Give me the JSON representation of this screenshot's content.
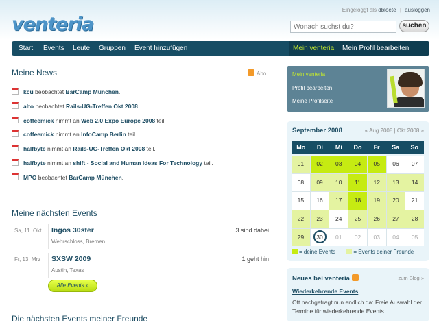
{
  "header": {
    "logo": "venteria",
    "logged_in_label": "Eingeloggt als",
    "username": "dbloete",
    "logout": "ausloggen",
    "search_placeholder": "Wonach suchst du?",
    "search_button": "suchen"
  },
  "nav": {
    "items": [
      "Start",
      "Events",
      "Leute",
      "Gruppen",
      "Event hinzufügen"
    ],
    "right_items": [
      "Mein venteria",
      "Mein Profil bearbeiten"
    ]
  },
  "news": {
    "title": "Meine News",
    "abo": "Abo",
    "items": [
      {
        "user": "kcu",
        "action": "beobachtet",
        "target": "BarCamp München",
        "end": "."
      },
      {
        "user": "alto",
        "action": "beobachtet",
        "target": "Rails-UG-Treffen Okt 2008",
        "end": "."
      },
      {
        "user": "coffeemick",
        "action": "nimmt an",
        "target": "Web 2.0 Expo Europe 2008",
        "end": " teil."
      },
      {
        "user": "coffeemick",
        "action": "nimmt an",
        "target": "InfoCamp Berlin",
        "end": " teil."
      },
      {
        "user": "halfbyte",
        "action": "nimmt an",
        "target": "Rails-UG-Treffen Okt 2008",
        "end": " teil."
      },
      {
        "user": "halfbyte",
        "action": "nimmt an",
        "target": "shift - Social and Human Ideas For Technology",
        "end": " teil."
      },
      {
        "user": "MPO",
        "action": "beobachtet",
        "target": "BarCamp München",
        "end": "."
      }
    ]
  },
  "events": {
    "title": "Meine nächsten Events",
    "items": [
      {
        "date": "Sa, 11. Okt",
        "title": "Ingos 30ster",
        "place": "Wehrschloss, Bremen",
        "count": "3 sind dabei"
      },
      {
        "date": "Fr, 13. Mrz",
        "title": "SXSW 2009",
        "place": "Austin, Texas",
        "count": "1 geht hin"
      }
    ],
    "all_button": "Alle Events »"
  },
  "friends_events": {
    "title": "Die nächsten Events meiner Freunde"
  },
  "profile": {
    "links": [
      "Mein venteria",
      "Profil bearbeiten",
      "Meine Profilseite"
    ]
  },
  "calendar": {
    "title": "September 2008",
    "prev": "« Aug 2008",
    "next": "Okt 2008 »",
    "weekdays": [
      "Mo",
      "Di",
      "Mi",
      "Do",
      "Fr",
      "Sa",
      "So"
    ],
    "days": [
      {
        "d": "01",
        "t": "fr"
      },
      {
        "d": "02",
        "t": "own"
      },
      {
        "d": "03",
        "t": "own"
      },
      {
        "d": "04",
        "t": "own"
      },
      {
        "d": "05",
        "t": "own"
      },
      {
        "d": "06",
        "t": ""
      },
      {
        "d": "07",
        "t": ""
      },
      {
        "d": "08",
        "t": ""
      },
      {
        "d": "09",
        "t": "fr"
      },
      {
        "d": "10",
        "t": "fr"
      },
      {
        "d": "11",
        "t": "own"
      },
      {
        "d": "12",
        "t": "fr"
      },
      {
        "d": "13",
        "t": "fr"
      },
      {
        "d": "14",
        "t": "fr"
      },
      {
        "d": "15",
        "t": ""
      },
      {
        "d": "16",
        "t": ""
      },
      {
        "d": "17",
        "t": "fr"
      },
      {
        "d": "18",
        "t": "own"
      },
      {
        "d": "19",
        "t": "fr"
      },
      {
        "d": "20",
        "t": "fr"
      },
      {
        "d": "21",
        "t": ""
      },
      {
        "d": "22",
        "t": "fr"
      },
      {
        "d": "23",
        "t": "fr"
      },
      {
        "d": "24",
        "t": ""
      },
      {
        "d": "25",
        "t": "fr"
      },
      {
        "d": "26",
        "t": "fr"
      },
      {
        "d": "27",
        "t": "fr"
      },
      {
        "d": "28",
        "t": "fr"
      },
      {
        "d": "29",
        "t": "fr"
      },
      {
        "d": "30",
        "t": "today"
      },
      {
        "d": "01",
        "t": "other"
      },
      {
        "d": "02",
        "t": "other"
      },
      {
        "d": "03",
        "t": "other"
      },
      {
        "d": "04",
        "t": "other"
      },
      {
        "d": "05",
        "t": "other"
      }
    ],
    "legend_own": "= deine Events",
    "legend_friends": "= Events deiner Freunde",
    "colors": {
      "own": "#c6eb12",
      "friends": "#e4f3a1"
    }
  },
  "neues": {
    "title": "Neues bei venteria",
    "blog": "zum Blog »",
    "post_title": "Wiederkehrende Events",
    "post_text": "Oft nachgefragt nun endlich da: Freie Auswahl der Termine für wiederkehrende Events."
  }
}
